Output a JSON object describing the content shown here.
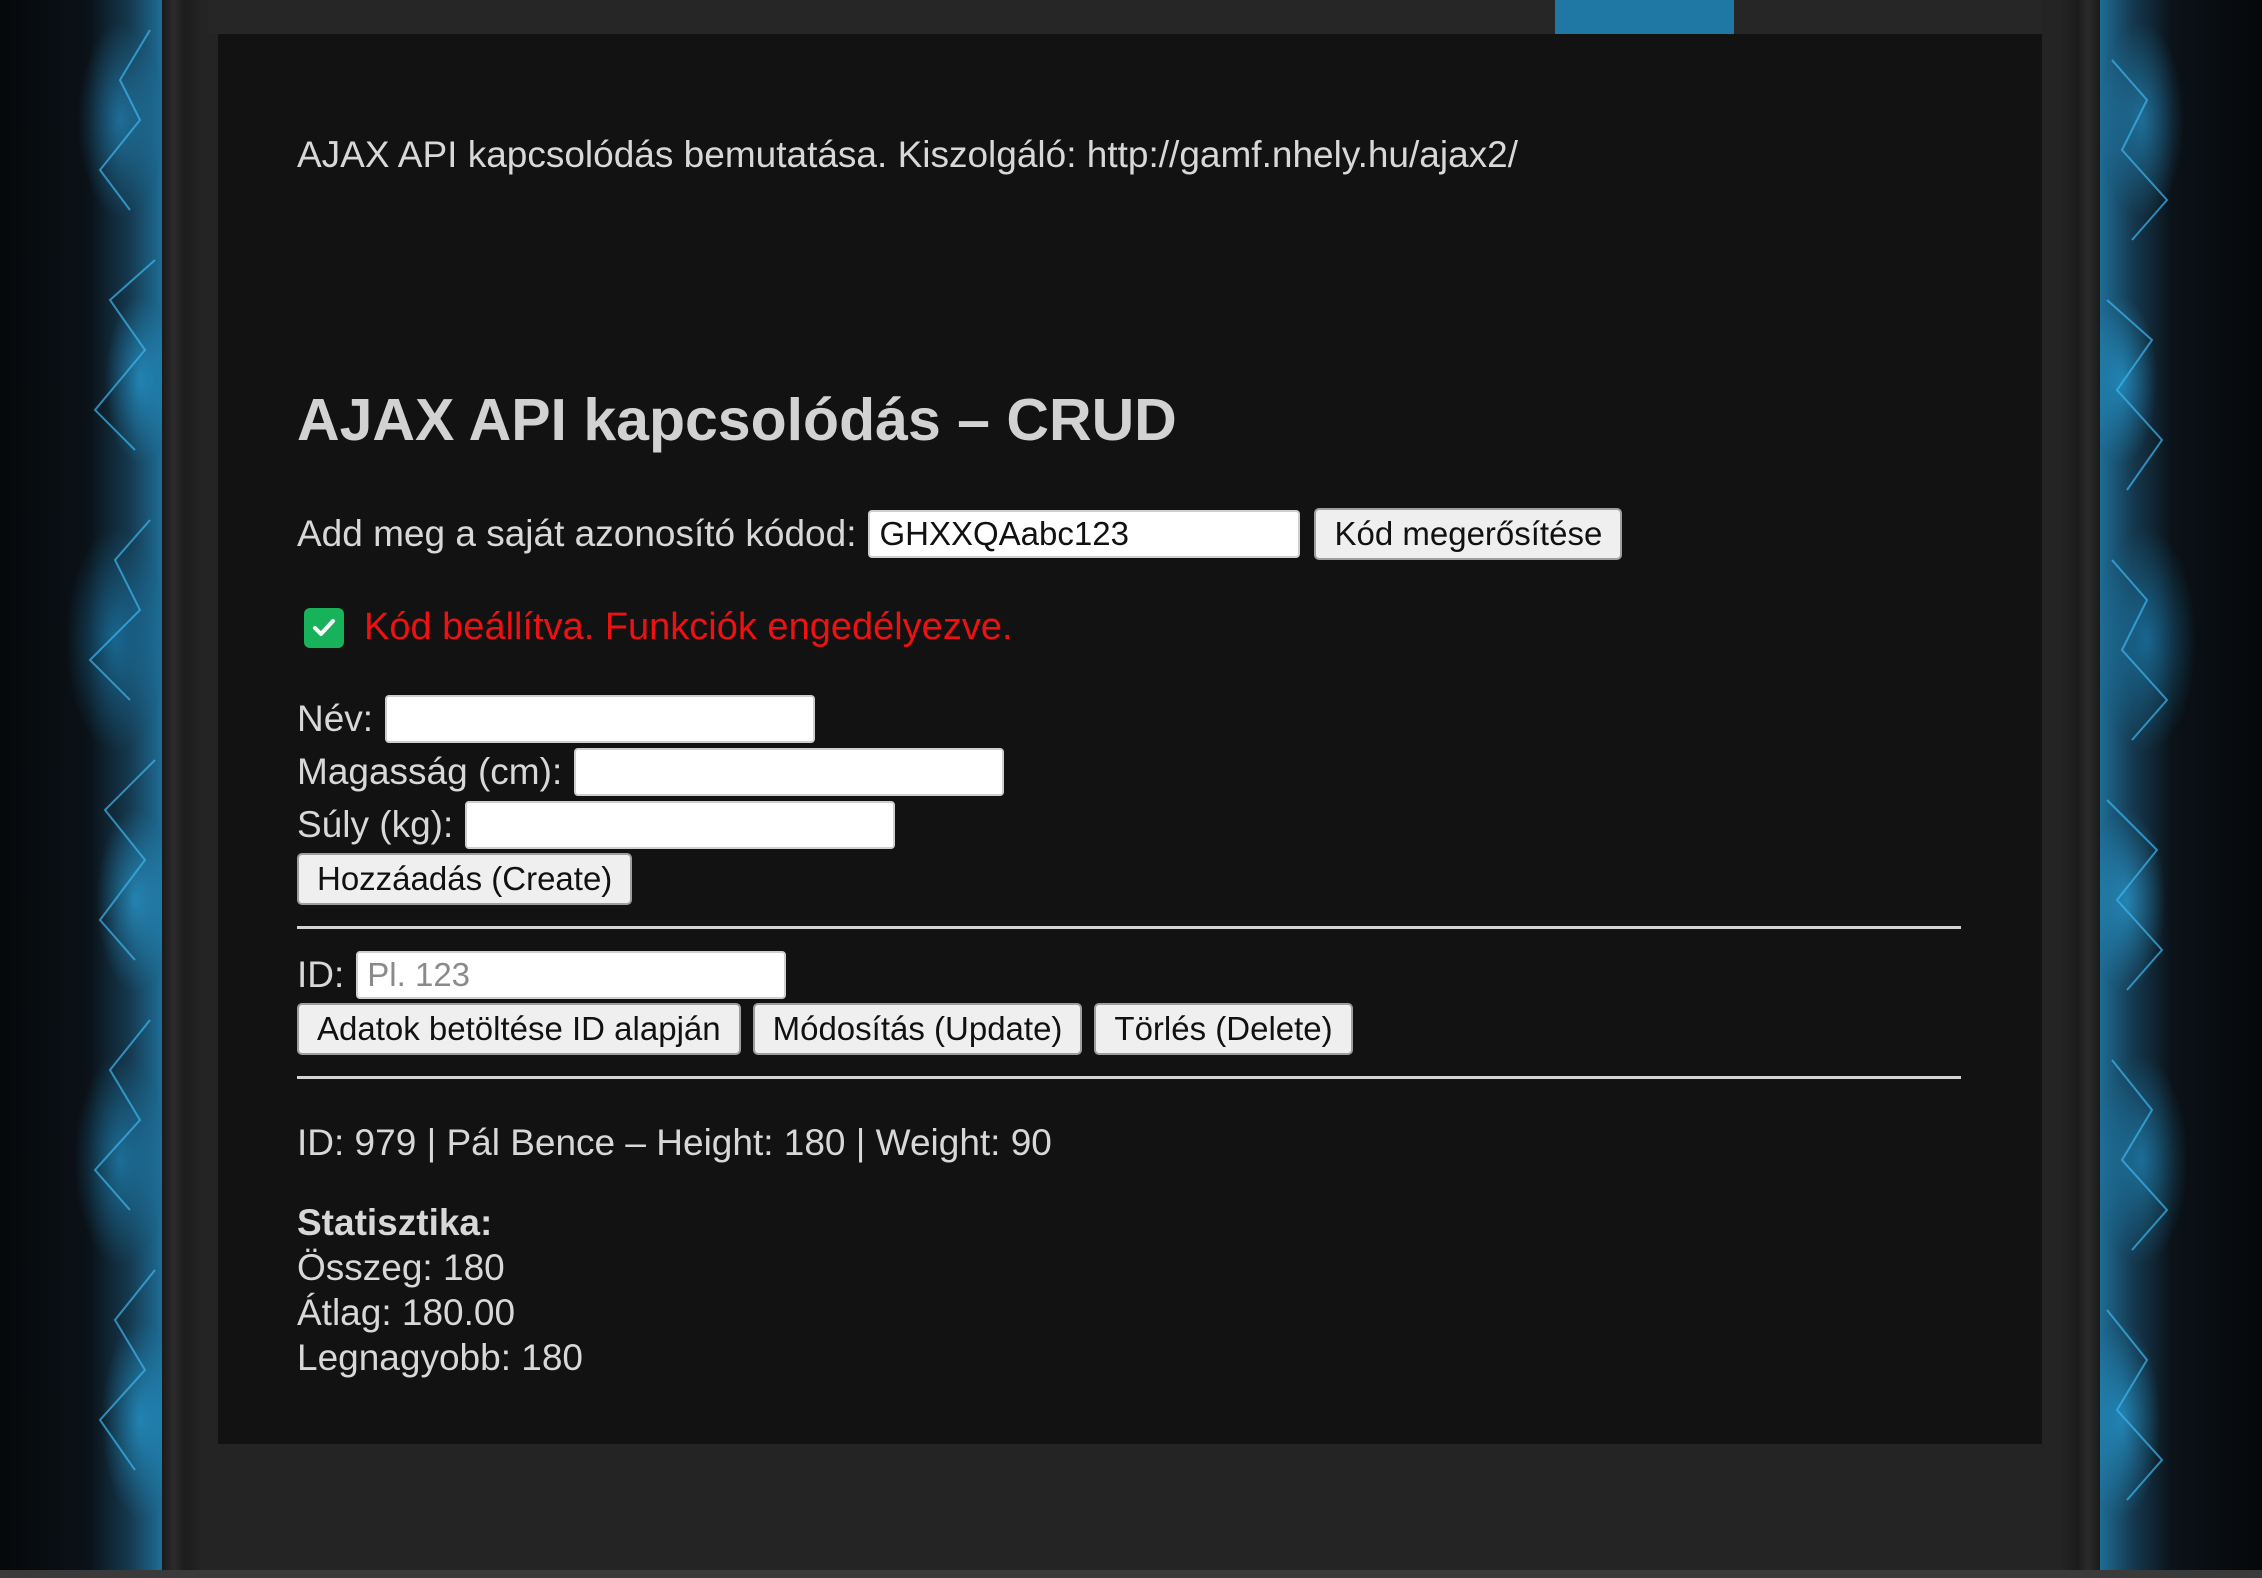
{
  "intro_text": "AJAX API kapcsolódás bemutatása. Kiszolgáló: http://gamf.nhely.hu/ajax2/",
  "title": "AJAX API kapcsolódás – CRUD",
  "code_section": {
    "label": "Add meg a saját azonosító kódod:",
    "value": "GHXXQAabc123",
    "confirm_button": "Kód megerősítése"
  },
  "status": {
    "icon": "check-icon",
    "text": "Kód beállítva. Funkciók engedélyezve.",
    "color": "#ee1111",
    "icon_color": "#18b25a"
  },
  "create_form": {
    "name_label": "Név:",
    "name_value": "",
    "height_label": "Magasság (cm):",
    "height_value": "",
    "weight_label": "Súly (kg):",
    "weight_value": "",
    "create_button": "Hozzáadás (Create)"
  },
  "id_form": {
    "id_label": "ID:",
    "id_placeholder": "Pl. 123",
    "load_button": "Adatok betöltése ID alapján",
    "update_button": "Módosítás (Update)",
    "delete_button": "Törlés (Delete)"
  },
  "record_line": "ID: 979 | Pál Bence – Height: 180 | Weight: 90",
  "stats": {
    "heading": "Statisztika:",
    "sum": "Összeg: 180",
    "avg": "Átlag: 180.00",
    "max": "Legnagyobb: 180"
  },
  "colors": {
    "accent_tab": "#1f78a3",
    "background": "#121212"
  }
}
